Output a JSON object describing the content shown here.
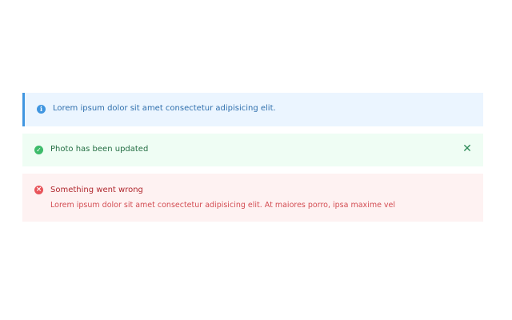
{
  "alerts": {
    "info": {
      "icon": "info-icon",
      "message": "Lorem ipsum dolor sit amet consectetur adipisicing elit."
    },
    "success": {
      "icon": "check-circle-icon",
      "message": "Photo has been updated",
      "close_icon": "close-icon"
    },
    "error": {
      "icon": "x-circle-icon",
      "title": "Something went wrong",
      "description": "Lorem ipsum dolor sit amet consectetur adipisicing elit. At maiores porro, ipsa maxime vel"
    }
  },
  "colors": {
    "info_bg": "#ebf5ff",
    "info_accent": "#4096e0",
    "success_bg": "#effdf4",
    "success_accent": "#3dbb6a",
    "error_bg": "#fef2f2",
    "error_accent": "#e8545a"
  }
}
